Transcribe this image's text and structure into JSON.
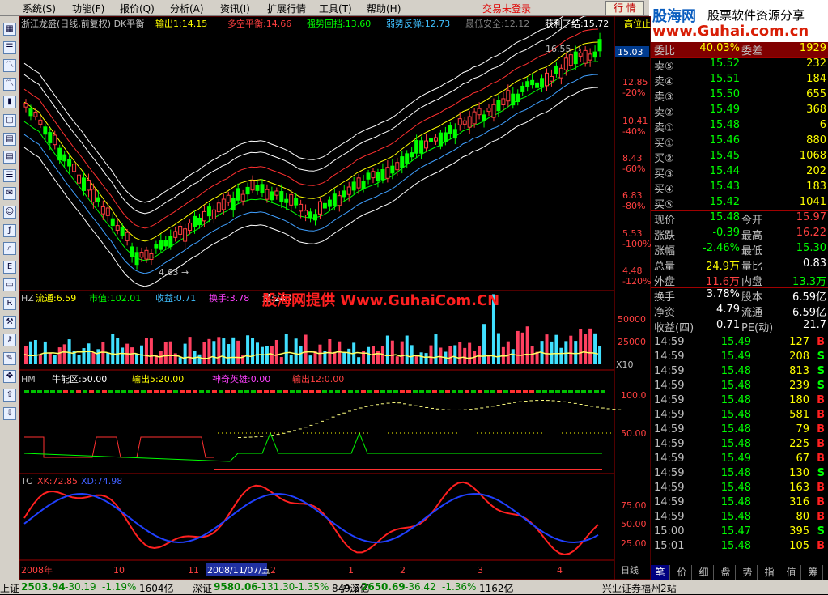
{
  "menu": [
    "系统(S)",
    "功能(F)",
    "报价(Q)",
    "分析(A)",
    "资讯(I)",
    "扩展行情",
    "工具(T)",
    "帮助(H)"
  ],
  "trade_status": "交易未登录",
  "row_button": "行 情",
  "brand": {
    "logo": "股海网",
    "slogan": "股票软件资源分享",
    "url": "www.Guhai.com.cn"
  },
  "main": {
    "title": "浙江龙盛(日线,前复权) DK平衡",
    "indicators": [
      {
        "text": "输出1:14.15",
        "color": "#ffff00"
      },
      {
        "text": "多空平衡:14.66",
        "color": "#ff4040"
      },
      {
        "text": "强势回挡:13.60",
        "color": "#00ff00"
      },
      {
        "text": "弱势反弹:12.73",
        "color": "#40c0ff"
      },
      {
        "text": "最低安全:12.12",
        "color": "#808080"
      },
      {
        "text": "获利了结:15.72",
        "color": "#ffffff"
      },
      {
        "text": "高位止",
        "color": "#ffff00"
      }
    ],
    "price_label": "15.03",
    "high_mark": "16.55",
    "low_mark": "4.63",
    "y_ticks": [
      {
        "price": "12.85",
        "pct": "-20%"
      },
      {
        "price": "10.41",
        "pct": "-40%"
      },
      {
        "price": "8.43",
        "pct": "-60%"
      },
      {
        "price": "6.83",
        "pct": "-80%"
      },
      {
        "price": "5.53",
        "pct": "-100%"
      },
      {
        "price": "4.48",
        "pct": "-120%"
      }
    ]
  },
  "volume": {
    "title": "HZ",
    "indicators": [
      {
        "text": "流通:6.59",
        "color": "#ffff00"
      },
      {
        "text": "市值:102.01",
        "color": "#00ff00"
      },
      {
        "text": "收益:0.71",
        "color": "#40c0ff"
      },
      {
        "text": "换手:3.78",
        "color": "#ff40ff"
      },
      {
        "text": "量:248",
        "color": "#ffffff"
      }
    ],
    "ticks": [
      "50000",
      "25000"
    ],
    "scale": "X10",
    "watermark": "股海网提供 Www.GuhaiCom.CN"
  },
  "hm": {
    "title": "HM",
    "indicators": [
      {
        "text": "牛能区:50.00",
        "color": "#ffffff"
      },
      {
        "text": "输出5:20.00",
        "color": "#ffff00"
      },
      {
        "text": "神奇英雄:0.00",
        "color": "#ff40ff"
      },
      {
        "text": "输出12:0.00",
        "color": "#ff4040"
      }
    ],
    "ticks": [
      "100.0",
      "50.00"
    ]
  },
  "tc": {
    "title": "TC",
    "indicators": [
      {
        "text": "XK:72.85",
        "color": "#ff4040"
      },
      {
        "text": "XD:74.98",
        "color": "#4060ff"
      }
    ],
    "ticks": [
      "75.00",
      "50.00",
      "25.00"
    ]
  },
  "date_axis": {
    "labels": [
      {
        "text": "2008年",
        "color": "#ff4040"
      },
      {
        "text": "10",
        "color": "#ff4040"
      },
      {
        "text": "11",
        "color": "#ff4040"
      },
      {
        "text": "2008/11/07/五",
        "color": "#ffffff"
      },
      {
        "text": "2",
        "color": "#ff4040"
      },
      {
        "text": "1",
        "color": "#ff4040"
      },
      {
        "text": "2",
        "color": "#ff4040"
      },
      {
        "text": "3",
        "color": "#ff4040"
      },
      {
        "text": "4",
        "color": "#ff4040"
      }
    ],
    "period": "日线"
  },
  "quote": {
    "ratio": {
      "label": "委比",
      "value": "40.03%",
      "label2": "委差",
      "value2": "1929"
    },
    "asks": [
      {
        "label": "卖⑤",
        "price": "15.52",
        "vol": "232"
      },
      {
        "label": "卖④",
        "price": "15.51",
        "vol": "184"
      },
      {
        "label": "卖③",
        "price": "15.50",
        "vol": "655"
      },
      {
        "label": "卖②",
        "price": "15.49",
        "vol": "368"
      },
      {
        "label": "卖①",
        "price": "15.48",
        "vol": "6"
      }
    ],
    "bids": [
      {
        "label": "买①",
        "price": "15.46",
        "vol": "880"
      },
      {
        "label": "买②",
        "price": "15.45",
        "vol": "1068"
      },
      {
        "label": "买③",
        "price": "15.44",
        "vol": "202"
      },
      {
        "label": "买④",
        "price": "15.43",
        "vol": "183"
      },
      {
        "label": "买⑤",
        "price": "15.42",
        "vol": "1041"
      }
    ],
    "stats": [
      {
        "l1": "现价",
        "v1": "15.48",
        "c1": "#00ff00",
        "l2": "今开",
        "v2": "15.97",
        "c2": "#ff4040"
      },
      {
        "l1": "涨跌",
        "v1": "-0.39",
        "c1": "#00ff00",
        "l2": "最高",
        "v2": "16.22",
        "c2": "#ff4040"
      },
      {
        "l1": "涨幅",
        "v1": "-2.46%",
        "c1": "#00ff00",
        "l2": "最低",
        "v2": "15.30",
        "c2": "#00ff00"
      },
      {
        "l1": "总量",
        "v1": "24.9万",
        "c1": "#ffff00",
        "l2": "量比",
        "v2": "0.83",
        "c2": "#ffffff"
      },
      {
        "l1": "外盘",
        "v1": "11.6万",
        "c1": "#ff4040",
        "l2": "内盘",
        "v2": "13.3万",
        "c2": "#00ff00"
      }
    ],
    "stats2": [
      {
        "l1": "换手",
        "v1": "3.78%",
        "l2": "股本",
        "v2": "6.59亿"
      },
      {
        "l1": "净资",
        "v1": "4.79",
        "l2": "流通",
        "v2": "6.59亿"
      },
      {
        "l1": "收益(四)",
        "v1": "0.71",
        "l2": "PE(动)",
        "v2": "21.7"
      }
    ],
    "ticks": [
      {
        "time": "14:59",
        "price": "15.49",
        "vol": "127",
        "dir": "B"
      },
      {
        "time": "14:59",
        "price": "15.49",
        "vol": "208",
        "dir": "S"
      },
      {
        "time": "14:59",
        "price": "15.48",
        "vol": "813",
        "dir": "S"
      },
      {
        "time": "14:59",
        "price": "15.48",
        "vol": "239",
        "dir": "S"
      },
      {
        "time": "14:59",
        "price": "15.48",
        "vol": "180",
        "dir": "B"
      },
      {
        "time": "14:59",
        "price": "15.48",
        "vol": "581",
        "dir": "B"
      },
      {
        "time": "14:59",
        "price": "15.48",
        "vol": "79",
        "dir": "B"
      },
      {
        "time": "14:59",
        "price": "15.48",
        "vol": "225",
        "dir": "B"
      },
      {
        "time": "14:59",
        "price": "15.49",
        "vol": "67",
        "dir": "B"
      },
      {
        "time": "14:59",
        "price": "15.48",
        "vol": "130",
        "dir": "S"
      },
      {
        "time": "14:59",
        "price": "15.48",
        "vol": "163",
        "dir": "B"
      },
      {
        "time": "14:59",
        "price": "15.48",
        "vol": "316",
        "dir": "B"
      },
      {
        "time": "14:59",
        "price": "15.48",
        "vol": "80",
        "dir": "B"
      },
      {
        "time": "15:00",
        "price": "15.47",
        "vol": "395",
        "dir": "S"
      },
      {
        "time": "15:01",
        "price": "15.48",
        "vol": "105",
        "dir": "B"
      }
    ],
    "tabs": [
      "笔",
      "价",
      "细",
      "盘",
      "势",
      "指",
      "值",
      "筹"
    ]
  },
  "status": {
    "items": [
      {
        "name": "上证",
        "val": "2503.94",
        "chg": "-30.19",
        "pct": "-1.19%",
        "amt": "1604亿"
      },
      {
        "name": "深证",
        "val": "9580.06",
        "chg": "-131.30",
        "pct": "-1.35%",
        "amt": "849.5亿"
      },
      {
        "name": "沪深",
        "val": "2650.69",
        "chg": "-36.42",
        "pct": "-1.36%",
        "amt": "1162亿"
      }
    ],
    "broker": "兴业证券福州2站"
  },
  "colors": {
    "up": "#ff4040",
    "down": "#00ff00",
    "vol_up": "#ff4060",
    "vol_down": "#40e0ff"
  }
}
